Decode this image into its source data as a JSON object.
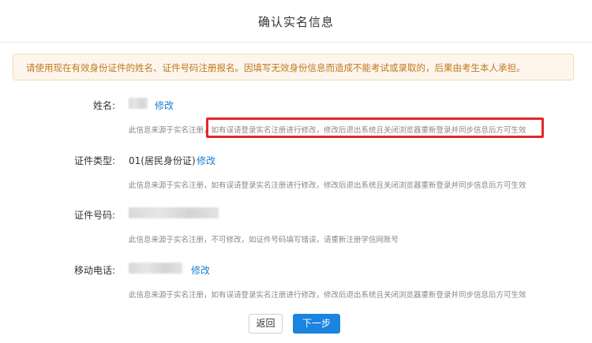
{
  "header": {
    "title": "确认实名信息"
  },
  "notice": {
    "text": "请使用现在有效身份证件的姓名、证件号码注册报名。因填写无效身份信息而造成不能考试或录取的，后果由考生本人承担。"
  },
  "fields": [
    {
      "label": "姓名:",
      "value": "",
      "edit_label": "修改",
      "hint_prefix": "此信息来源于实名注册，",
      "hint_rest": "如有误请登录实名注册进行修改，修改后退出系统且关闭浏览器重新登录并同步信息后方可生效"
    },
    {
      "label": "证件类型:",
      "value": "01(居民身份证)",
      "edit_label": "修改",
      "hint": "此信息来源于实名注册，如有误请登录实名注册进行修改，修改后退出系统且关闭浏览器重新登录并同步信息后方可生效"
    },
    {
      "label": "证件号码:",
      "value": "",
      "hint": "此信息来源于实名注册，不可修改，如证件号码填写错误，请重新注册学信网账号"
    },
    {
      "label": "移动电话:",
      "value": "",
      "edit_label": "修改",
      "hint": "此信息来源于实名注册，如有误请登录实名注册进行修改，修改后退出系统且关闭浏览器重新登录并同步信息后方可生效"
    }
  ],
  "buttons": {
    "back_label": "返回",
    "next_label": "下一步"
  },
  "colors": {
    "link": "#1a7fd3",
    "primary": "#1a84e0",
    "highlight": "#e32828",
    "notice_bg": "#fdf6ec",
    "notice_text": "#c0771f"
  }
}
